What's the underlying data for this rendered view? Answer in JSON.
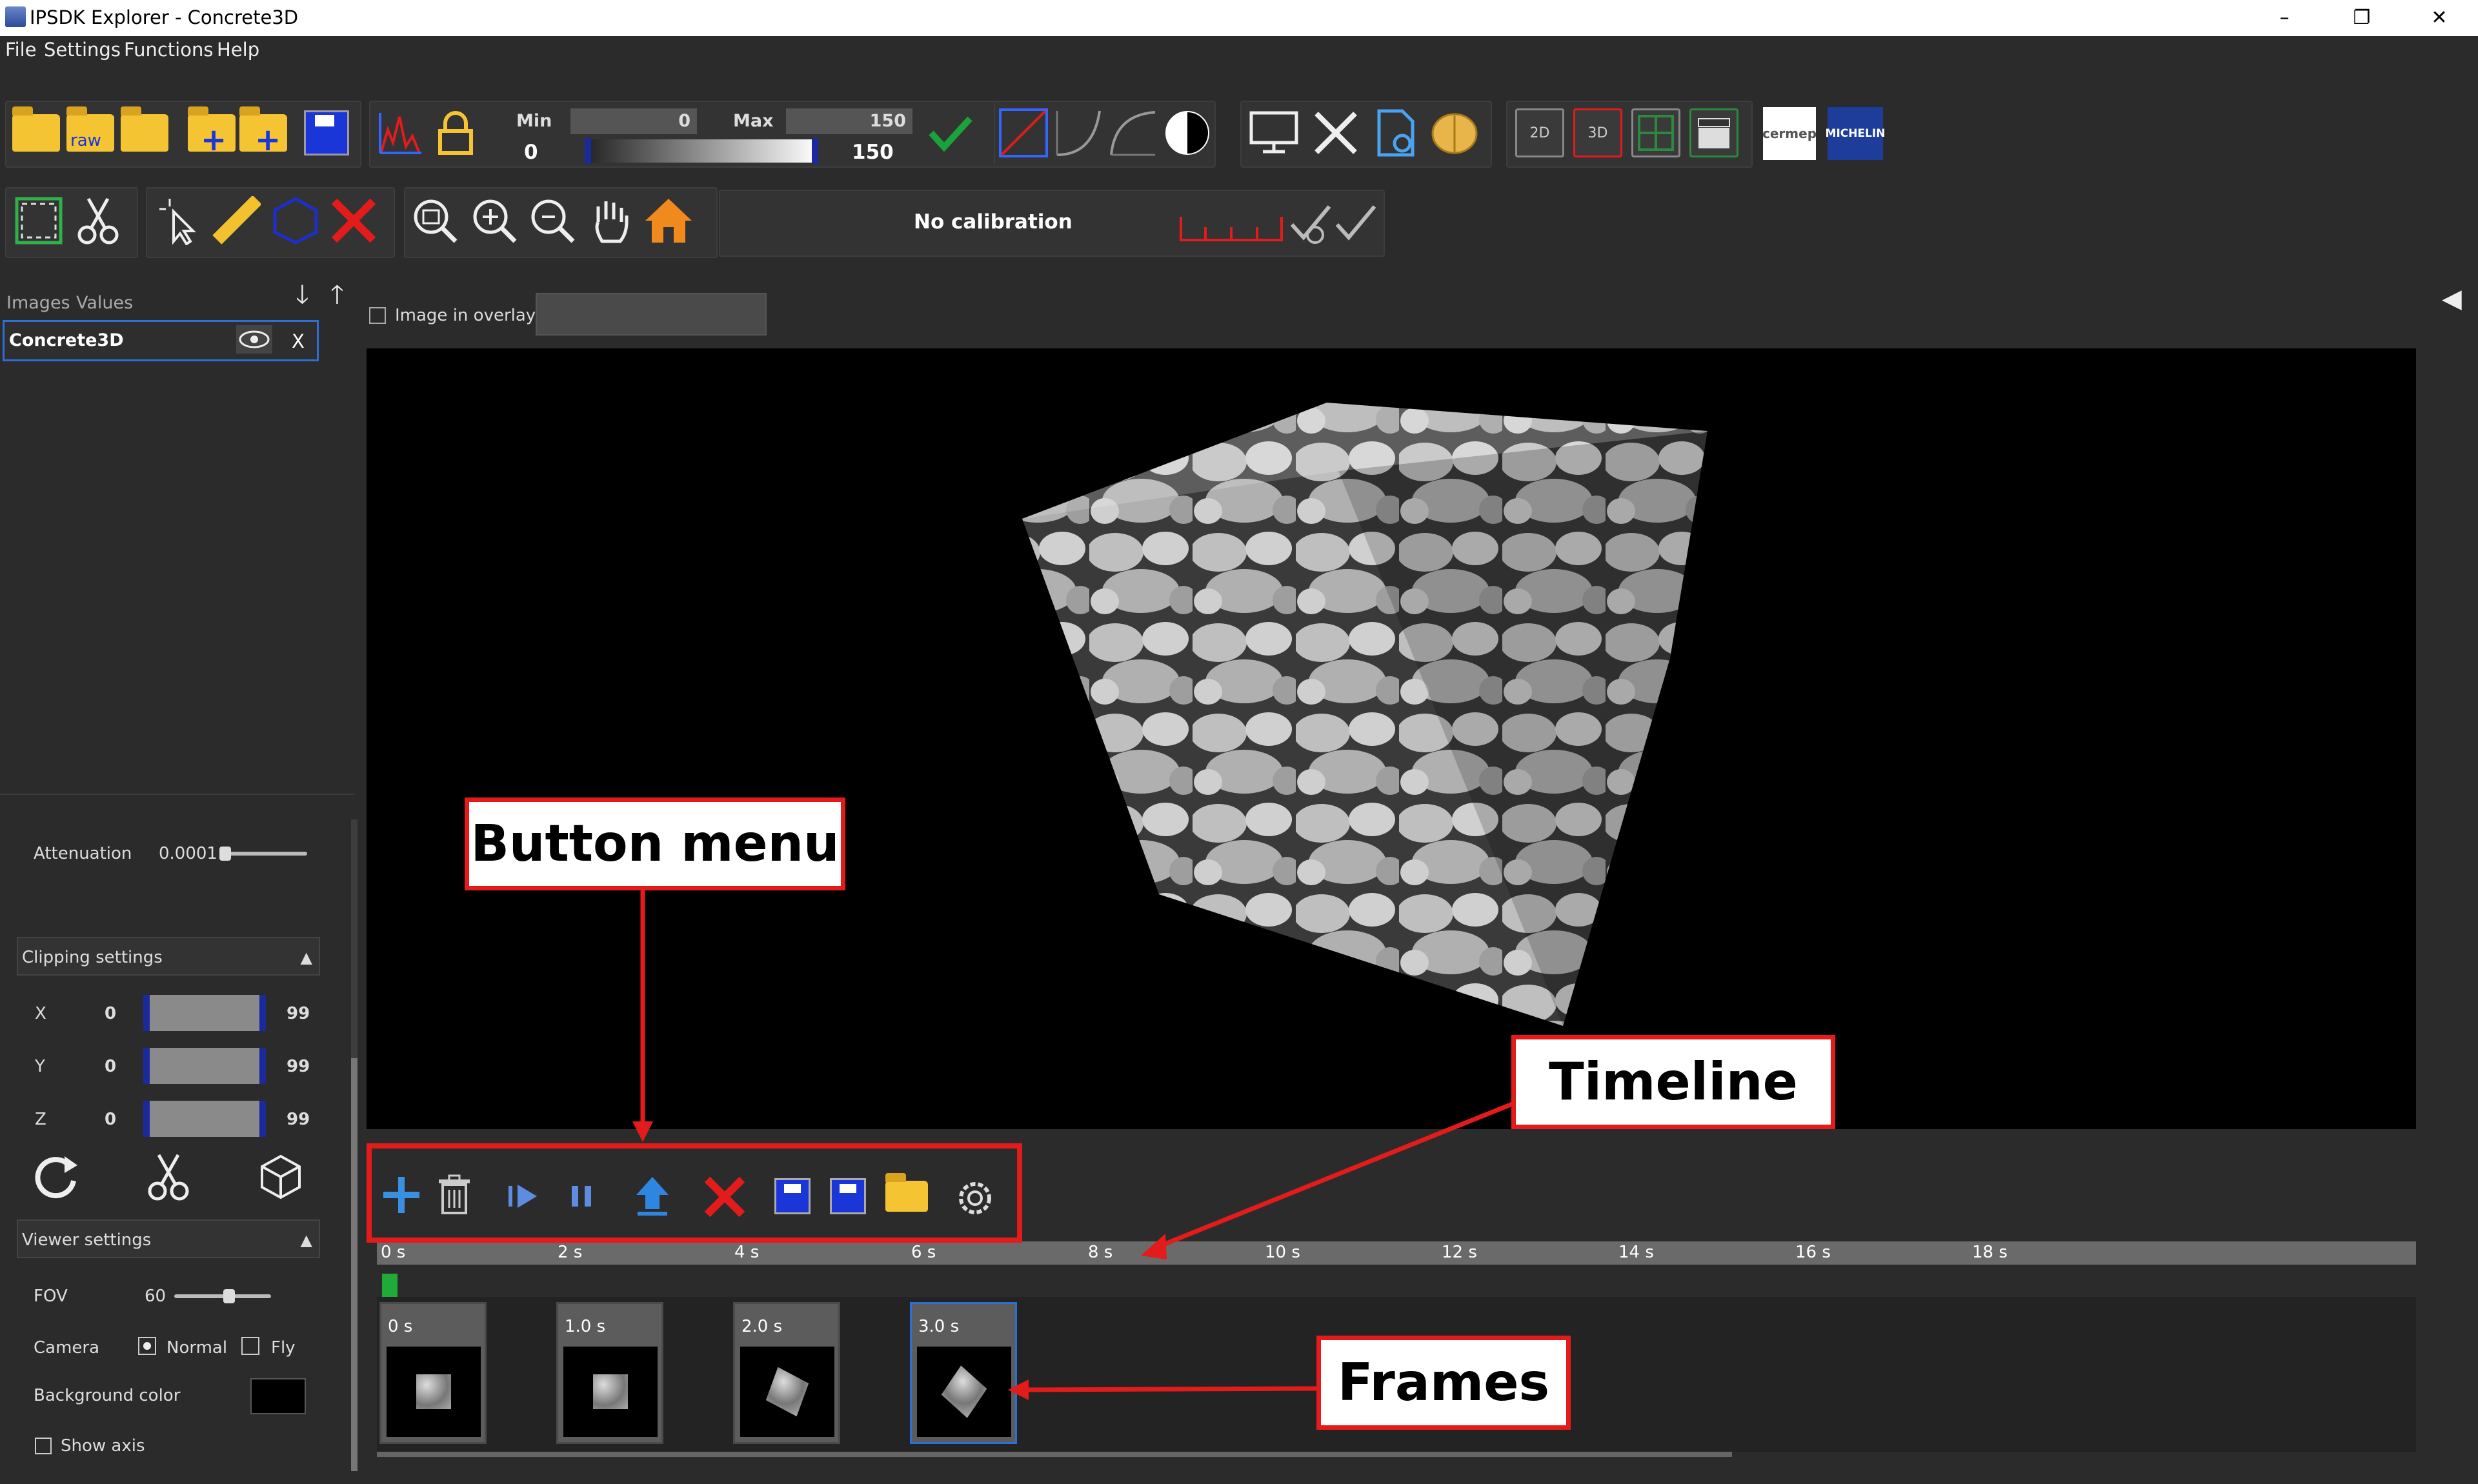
{
  "window": {
    "title": "IPSDK Explorer - Concrete3D",
    "minimize": "–",
    "restore": "❐",
    "close": "✕"
  },
  "menu": [
    "File",
    "Settings",
    "Functions",
    "Help"
  ],
  "toolbar": {
    "min_label": "Min",
    "max_label": "Max",
    "min_value": "0",
    "max_value": "150",
    "min_low": "0",
    "max_high": "150",
    "view_2d": "2D",
    "view_3d": "3D",
    "logo1": "cermep",
    "logo2": "MICHELIN",
    "raw_label": "raw",
    "calibration": "No calibration"
  },
  "left": {
    "tabs": [
      "Images",
      "Values"
    ],
    "image_item": "Concrete3D",
    "image_close": "X",
    "attenuation_label": "Attenuation",
    "attenuation_value": "0.0001",
    "clipping_header": "Clipping settings",
    "clip": [
      {
        "axis": "X",
        "min": "0",
        "max": "99"
      },
      {
        "axis": "Y",
        "min": "0",
        "max": "99"
      },
      {
        "axis": "Z",
        "min": "0",
        "max": "99"
      }
    ],
    "viewer_header": "Viewer settings",
    "fov_label": "FOV",
    "fov_value": "60",
    "camera_label": "Camera",
    "camera_normal": "Normal",
    "camera_fly": "Fly",
    "bg_label": "Background color",
    "show_axis": "Show axis"
  },
  "overlay": {
    "label": "Image in overlay"
  },
  "annotations": {
    "button_menu": "Button menu",
    "timeline": "Timeline",
    "frames": "Frames"
  },
  "timeline": {
    "ticks": [
      "0 s",
      "2 s",
      "4 s",
      "6 s",
      "8 s",
      "10 s",
      "12 s",
      "14 s",
      "16 s",
      "18 s"
    ],
    "frames": [
      "0 s",
      "1.0 s",
      "2.0 s",
      "3.0 s"
    ]
  },
  "colors": {
    "accent_red": "#e41b1b",
    "panel": "#2b2b2b",
    "viewer_bg": "#000000"
  }
}
